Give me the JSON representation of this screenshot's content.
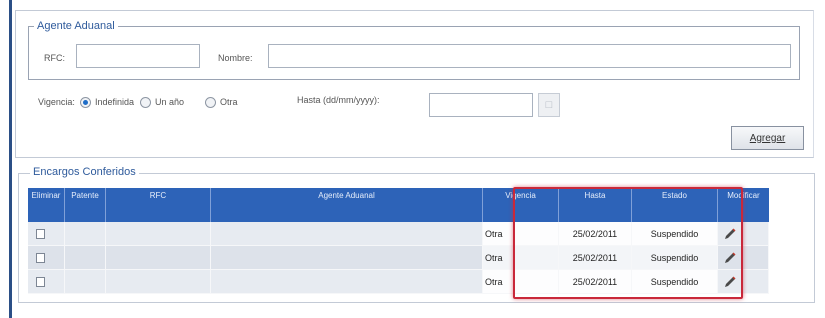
{
  "agente": {
    "legend": "Agente Aduanal",
    "rfc_label": "RFC:",
    "rfc_value": "",
    "nombre_label": "Nombre:",
    "nombre_value": "",
    "vigencia_label": "Vigencia:",
    "radio_options": [
      "Indefinida",
      "Un año",
      "Otra"
    ],
    "radio_selected": "Indefinida",
    "hasta_label": "Hasta (dd/mm/yyyy):",
    "hasta_value": "",
    "agregar_label": "Agregar"
  },
  "encargos": {
    "legend": "Encargos Conferidos",
    "columns": [
      "Eliminar",
      "Patente",
      "RFC",
      "Agente Aduanal",
      "Vigencia",
      "Hasta",
      "Estado",
      "Modificar"
    ],
    "rows": [
      {
        "patente": "",
        "rfc": "",
        "agente": "",
        "vigencia": "Otra",
        "hasta": "25/02/2011",
        "estado": "Suspendido"
      },
      {
        "patente": "",
        "rfc": "",
        "agente": "",
        "vigencia": "Otra",
        "hasta": "25/02/2011",
        "estado": "Suspendido"
      },
      {
        "patente": "",
        "rfc": "",
        "agente": "",
        "vigencia": "Otra",
        "hasta": "25/02/2011",
        "estado": "Suspendido"
      }
    ]
  },
  "colors": {
    "header_blue": "#2d63b8",
    "legend_blue": "#2f5b9c",
    "highlight_red": "#c9283a"
  },
  "icons": {
    "calendar": "calendar-icon",
    "edit": "pencil-icon"
  }
}
